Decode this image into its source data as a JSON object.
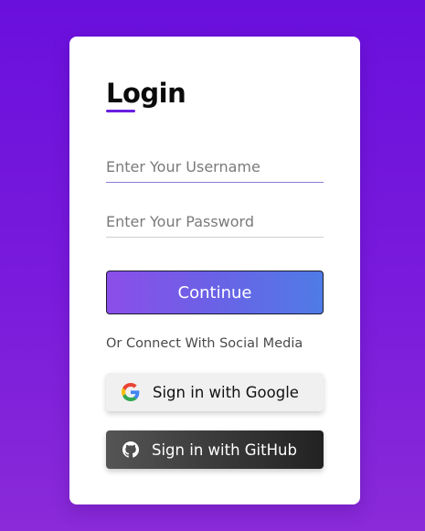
{
  "colors": {
    "background": "#6a10dd",
    "accent": "#6a1fe0",
    "card": "#ffffff",
    "continue_gradient_start": "#8b4ee8",
    "continue_gradient_end": "#4f7be6",
    "github_button": "#333333",
    "google_button": "#f0f0f0"
  },
  "login": {
    "title": "Login",
    "username": {
      "placeholder": "Enter Your Username",
      "value": ""
    },
    "password": {
      "placeholder": "Enter Your Password",
      "value": ""
    },
    "continue_label": "Continue",
    "social_prompt": "Or Connect With Social Media",
    "google": {
      "label": "Sign in with Google",
      "icon": "google-icon"
    },
    "github": {
      "label": "Sign in with GitHub",
      "icon": "github-icon"
    }
  }
}
